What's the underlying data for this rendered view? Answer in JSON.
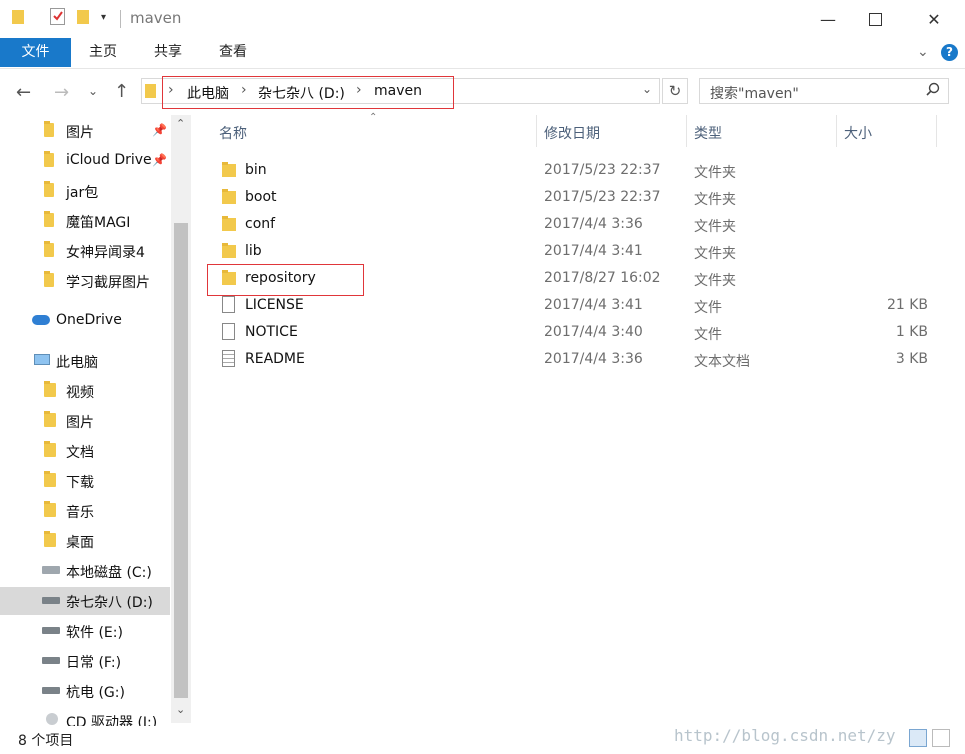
{
  "window": {
    "title": "maven"
  },
  "ribbon": {
    "tabs": [
      {
        "label": "文件"
      },
      {
        "label": "主页"
      },
      {
        "label": "共享"
      },
      {
        "label": "查看"
      }
    ],
    "help": "?"
  },
  "address": {
    "breadcrumb": [
      "此电脑",
      "杂七杂八 (D:)",
      "maven"
    ],
    "search_placeholder": "搜索\"maven\""
  },
  "nav": {
    "quick_access": [
      {
        "label": "图片",
        "pinned": true
      },
      {
        "label": "iCloud Drive",
        "pinned": true
      },
      {
        "label": "jar包"
      },
      {
        "label": "魔笛MAGI"
      },
      {
        "label": "女神异闻录4"
      },
      {
        "label": "学习截屏图片"
      }
    ],
    "onedrive": "OneDrive",
    "this_pc": "此电脑",
    "pc_items": [
      {
        "label": "视频"
      },
      {
        "label": "图片"
      },
      {
        "label": "文档"
      },
      {
        "label": "下载"
      },
      {
        "label": "音乐"
      },
      {
        "label": "桌面"
      }
    ],
    "drives": [
      {
        "label": "本地磁盘 (C:)"
      },
      {
        "label": "杂七杂八 (D:)",
        "selected": true
      },
      {
        "label": "软件 (E:)"
      },
      {
        "label": "日常 (F:)"
      },
      {
        "label": "杭电 (G:)"
      },
      {
        "label": "CD 驱动器 (I:)"
      }
    ]
  },
  "list": {
    "columns": [
      "名称",
      "修改日期",
      "类型",
      "大小"
    ],
    "rows": [
      {
        "name": "bin",
        "date": "2017/5/23 22:37",
        "type": "文件夹",
        "size": "",
        "icon": "folder-icon"
      },
      {
        "name": "boot",
        "date": "2017/5/23 22:37",
        "type": "文件夹",
        "size": "",
        "icon": "folder-icon"
      },
      {
        "name": "conf",
        "date": "2017/4/4 3:36",
        "type": "文件夹",
        "size": "",
        "icon": "folder-icon"
      },
      {
        "name": "lib",
        "date": "2017/4/4 3:41",
        "type": "文件夹",
        "size": "",
        "icon": "folder-icon"
      },
      {
        "name": "repository",
        "date": "2017/8/27 16:02",
        "type": "文件夹",
        "size": "",
        "icon": "folder-icon"
      },
      {
        "name": "LICENSE",
        "date": "2017/4/4 3:41",
        "type": "文件",
        "size": "21 KB",
        "icon": "file-icon"
      },
      {
        "name": "NOTICE",
        "date": "2017/4/4 3:40",
        "type": "文件",
        "size": "1 KB",
        "icon": "file-icon"
      },
      {
        "name": "README",
        "date": "2017/4/4 3:36",
        "type": "文本文档",
        "size": "3 KB",
        "icon": "text-file-icon"
      }
    ]
  },
  "status": {
    "count": "8 个项目"
  },
  "watermark": "http://blog.csdn.net/zy",
  "colors": {
    "accent": "#1979ca",
    "highlight_box": "#e0363a",
    "folder": "#f2c94c"
  }
}
